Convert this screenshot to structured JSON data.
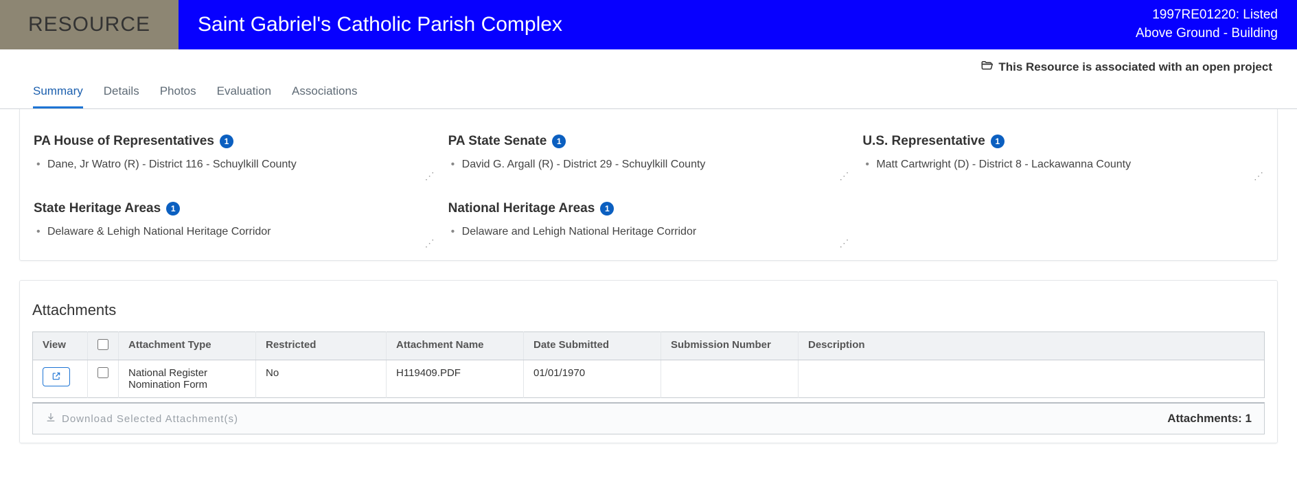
{
  "header": {
    "label": "RESOURCE",
    "title": "Saint Gabriel's Catholic Parish Complex",
    "meta_line1": "1997RE01220: Listed",
    "meta_line2": "Above Ground - Building"
  },
  "open_project_notice": "This Resource is associated with an open project",
  "tabs": [
    "Summary",
    "Details",
    "Photos",
    "Evaluation",
    "Associations"
  ],
  "active_tab": "Summary",
  "info_sections": [
    {
      "title": "PA House of Representatives",
      "count": "1",
      "items": [
        "Dane, Jr Watro (R) - District 116 - Schuylkill County"
      ]
    },
    {
      "title": "PA State Senate",
      "count": "1",
      "items": [
        "David G. Argall (R) - District 29 - Schuylkill County"
      ]
    },
    {
      "title": "U.S. Representative",
      "count": "1",
      "items": [
        "Matt Cartwright (D) - District 8 - Lackawanna County"
      ]
    },
    {
      "title": "State Heritage Areas",
      "count": "1",
      "items": [
        "Delaware & Lehigh National Heritage Corridor"
      ]
    },
    {
      "title": "National Heritage Areas",
      "count": "1",
      "items": [
        "Delaware and Lehigh National Heritage Corridor"
      ]
    }
  ],
  "attachments": {
    "title": "Attachments",
    "columns": {
      "view": "View",
      "type": "Attachment Type",
      "restricted": "Restricted",
      "name": "Attachment Name",
      "date": "Date Submitted",
      "submission": "Submission Number",
      "description": "Description"
    },
    "rows": [
      {
        "type": "National Register Nomination Form",
        "restricted": "No",
        "name": "H119409.PDF",
        "date": "01/01/1970",
        "submission": "",
        "description": ""
      }
    ],
    "download_label": "Download Selected Attachment(s)",
    "count_label": "Attachments: 1"
  }
}
